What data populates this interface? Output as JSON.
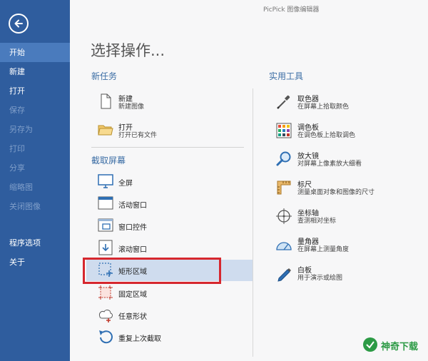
{
  "app_title": "PicPick 图像编辑器",
  "page_title": "选择操作...",
  "sidebar": {
    "items": [
      {
        "label": "开始",
        "state": "active"
      },
      {
        "label": "新建",
        "state": "normal"
      },
      {
        "label": "打开",
        "state": "normal"
      },
      {
        "label": "保存",
        "state": "disabled"
      },
      {
        "label": "另存为",
        "state": "disabled"
      },
      {
        "label": "打印",
        "state": "disabled"
      },
      {
        "label": "分享",
        "state": "disabled"
      },
      {
        "label": "缩略图",
        "state": "disabled"
      },
      {
        "label": "关闭图像",
        "state": "disabled"
      }
    ],
    "bottom_items": [
      {
        "label": "程序选项"
      },
      {
        "label": "关于"
      }
    ]
  },
  "new_task": {
    "title": "新任务",
    "items": [
      {
        "title": "新建",
        "desc": "新建图像",
        "icon": "document-icon"
      },
      {
        "title": "打开",
        "desc": "打开已有文件",
        "icon": "folder-icon"
      }
    ]
  },
  "capture": {
    "title": "截取屏幕",
    "items": [
      {
        "label": "全屏",
        "icon": "monitor-icon"
      },
      {
        "label": "活动窗口",
        "icon": "window-icon"
      },
      {
        "label": "窗口控件",
        "icon": "window-control-icon"
      },
      {
        "label": "滚动窗口",
        "icon": "scroll-window-icon"
      },
      {
        "label": "矩形区域",
        "icon": "rectangle-region-icon",
        "selected": true
      },
      {
        "label": "固定区域",
        "icon": "fixed-region-icon"
      },
      {
        "label": "任意形状",
        "icon": "freehand-shape-icon"
      },
      {
        "label": "重复上次截取",
        "icon": "repeat-icon"
      }
    ]
  },
  "tools": {
    "title": "实用工具",
    "items": [
      {
        "title": "取色器",
        "desc": "在屏幕上拾取颜色",
        "icon": "eyedropper-icon"
      },
      {
        "title": "调色板",
        "desc": "在调色板上拾取调色",
        "icon": "palette-icon"
      },
      {
        "title": "放大镜",
        "desc": "对屏幕上像素放大细看",
        "icon": "magnifier-icon"
      },
      {
        "title": "标尺",
        "desc": "测量桌面对象和图像的尺寸",
        "icon": "ruler-icon"
      },
      {
        "title": "坐标轴",
        "desc": "查测相对坐标",
        "icon": "crosshair-icon"
      },
      {
        "title": "量角器",
        "desc": "在屏幕上测量角度",
        "icon": "protractor-icon"
      },
      {
        "title": "白板",
        "desc": "用于演示或绘图",
        "icon": "pen-icon"
      }
    ]
  },
  "watermark": {
    "text": "神奇下载"
  },
  "colors": {
    "sidebar": "#2f5d9e",
    "sidebar_active": "#4a7bbd",
    "section_title": "#3c6ea5",
    "highlight": "#d6272e",
    "selected_bg": "#cfdcee"
  }
}
